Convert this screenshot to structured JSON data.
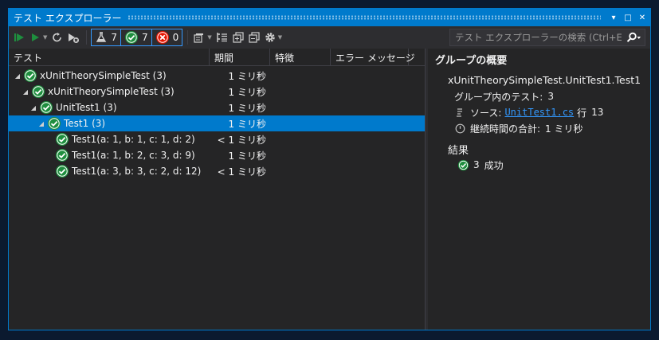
{
  "window": {
    "title": "テスト エクスプローラー",
    "buttons": {
      "pin": "▾",
      "maximize": "□",
      "close": "✕"
    }
  },
  "toolbar": {
    "filters": [
      {
        "icon": "flask-icon",
        "count": "7",
        "color": "#d0d0d0"
      },
      {
        "icon": "passed-icon",
        "count": "7",
        "color": "#1e8e3e"
      },
      {
        "icon": "failed-icon",
        "count": "0",
        "color": "#e51400"
      }
    ],
    "search_placeholder": "テスト エクスプローラーの検索 (Ctrl+E)"
  },
  "columns": {
    "test": "テスト",
    "duration": "期間",
    "traits": "特徴",
    "error": "エラー メッセージ"
  },
  "tests": [
    {
      "name": "xUnitTheorySimpleTest (3)",
      "duration": "1 ミリ秒",
      "expand": "◢",
      "bold": false
    },
    {
      "name": "xUnitTheorySimpleTest (3)",
      "duration": "1 ミリ秒",
      "expand": "◢",
      "bold": false
    },
    {
      "name": "UnitTest1 (3)",
      "duration": "1 ミリ秒",
      "expand": "◢",
      "bold": false
    },
    {
      "name": "Test1 (3)",
      "duration": "1 ミリ秒",
      "expand": "◢",
      "bold": false,
      "selected": true
    },
    {
      "name": "Test1(a: 1, b: 1, c: 1, d: 2)",
      "duration": "< 1 ミリ秒",
      "expand": "",
      "bold": false
    },
    {
      "name": "Test1(a: 1, b: 2, c: 3, d: 9)",
      "duration": "1 ミリ秒",
      "expand": "",
      "bold": false
    },
    {
      "name": "Test1(a: 3, b: 3, c: 2, d: 12)",
      "duration": "< 1 ミリ秒",
      "expand": "",
      "bold": false
    }
  ],
  "summary": {
    "title": "グループの概要",
    "group_name": "xUnitTheorySimpleTest.UnitTest1.Test1",
    "tests_in_group_label": "グループ内のテスト:",
    "tests_in_group_value": "3",
    "source_label": "ソース:",
    "source_file": "UnitTest1.cs",
    "source_line_label": "行",
    "source_line": "13",
    "total_duration_label": "継続時間の合計:",
    "total_duration_value": "1 ミリ秒",
    "results_label": "結果",
    "passed_count": "3",
    "passed_label": "成功"
  },
  "colors": {
    "accent": "#007acc",
    "pass": "#1e8e3e",
    "fail": "#e51400",
    "background": "#252526",
    "link": "#3399ff"
  }
}
